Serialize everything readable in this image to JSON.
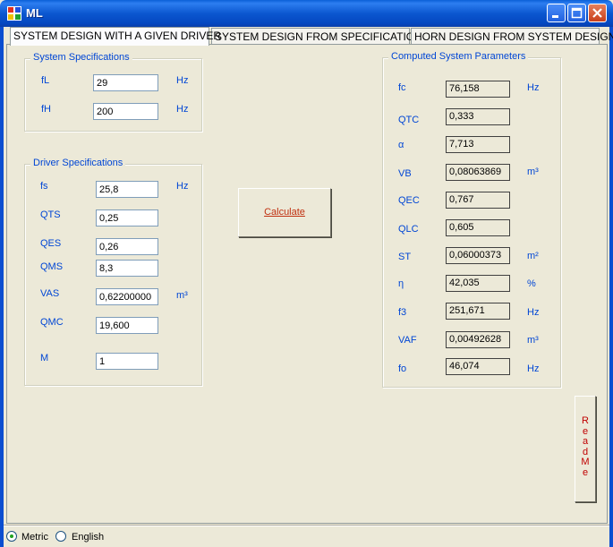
{
  "window": {
    "title": "ML",
    "app_icon": "app-window-icon",
    "controls": [
      "minimize-icon",
      "maximize-icon",
      "close-icon"
    ]
  },
  "tabs": [
    {
      "label": "SYSTEM DESIGN WITH A GIVEN DRIVER",
      "active": true
    },
    {
      "label": "SYSTEM DESIGN FROM SPECIFICATIONS",
      "active": false
    },
    {
      "label": "HORN DESIGN FROM SYSTEM DESIGN",
      "active": false
    }
  ],
  "system_specs": {
    "title": "System Specifications",
    "fields": [
      {
        "label": "fL",
        "value": "29",
        "unit": "Hz"
      },
      {
        "label": "fH",
        "value": "200",
        "unit": "Hz"
      }
    ]
  },
  "driver_specs": {
    "title": "Driver Specifications",
    "fields": [
      {
        "label": "fs",
        "value": "25,8",
        "unit": "Hz"
      },
      {
        "label": "QTS",
        "value": "0,25",
        "unit": ""
      },
      {
        "label": "QES",
        "value": "0,26",
        "unit": ""
      },
      {
        "label": "QMS",
        "value": "8,3",
        "unit": ""
      },
      {
        "label": "VAS",
        "value": "0,62200000",
        "unit": "m³"
      },
      {
        "label": "QMC",
        "value": "19,600",
        "unit": ""
      },
      {
        "label": "M",
        "value": "1",
        "unit": ""
      }
    ]
  },
  "calculate_button": {
    "label": "Calculate"
  },
  "computed": {
    "title": "Computed System Parameters",
    "fields": [
      {
        "label": "fc",
        "value": "76,158",
        "unit": "Hz"
      },
      {
        "label": "QTC",
        "value": "0,333",
        "unit": ""
      },
      {
        "label": "α",
        "value": "7,713",
        "unit": ""
      },
      {
        "label": "VB",
        "value": "0,08063869",
        "unit": "m³"
      },
      {
        "label": "QEC",
        "value": "0,767",
        "unit": ""
      },
      {
        "label": "QLC",
        "value": "0,605",
        "unit": ""
      },
      {
        "label": "ST",
        "value": "0,06000373",
        "unit": "m²"
      },
      {
        "label": "η",
        "value": "42,035",
        "unit": "%"
      },
      {
        "label": "f3",
        "value": "251,671",
        "unit": "Hz"
      },
      {
        "label": "VAF",
        "value": "0,00492628",
        "unit": "m³"
      },
      {
        "label": "fo",
        "value": "46,074",
        "unit": "Hz"
      }
    ]
  },
  "readme_button": {
    "label": "ReadMe"
  },
  "units": {
    "options": [
      {
        "label": "Metric",
        "selected": true
      },
      {
        "label": "English",
        "selected": false
      }
    ]
  },
  "colors": {
    "label_blue": "#0046d5",
    "calculate_text": "#c03010",
    "readme_text": "#c00000",
    "titlebar": "#0b57d0"
  }
}
